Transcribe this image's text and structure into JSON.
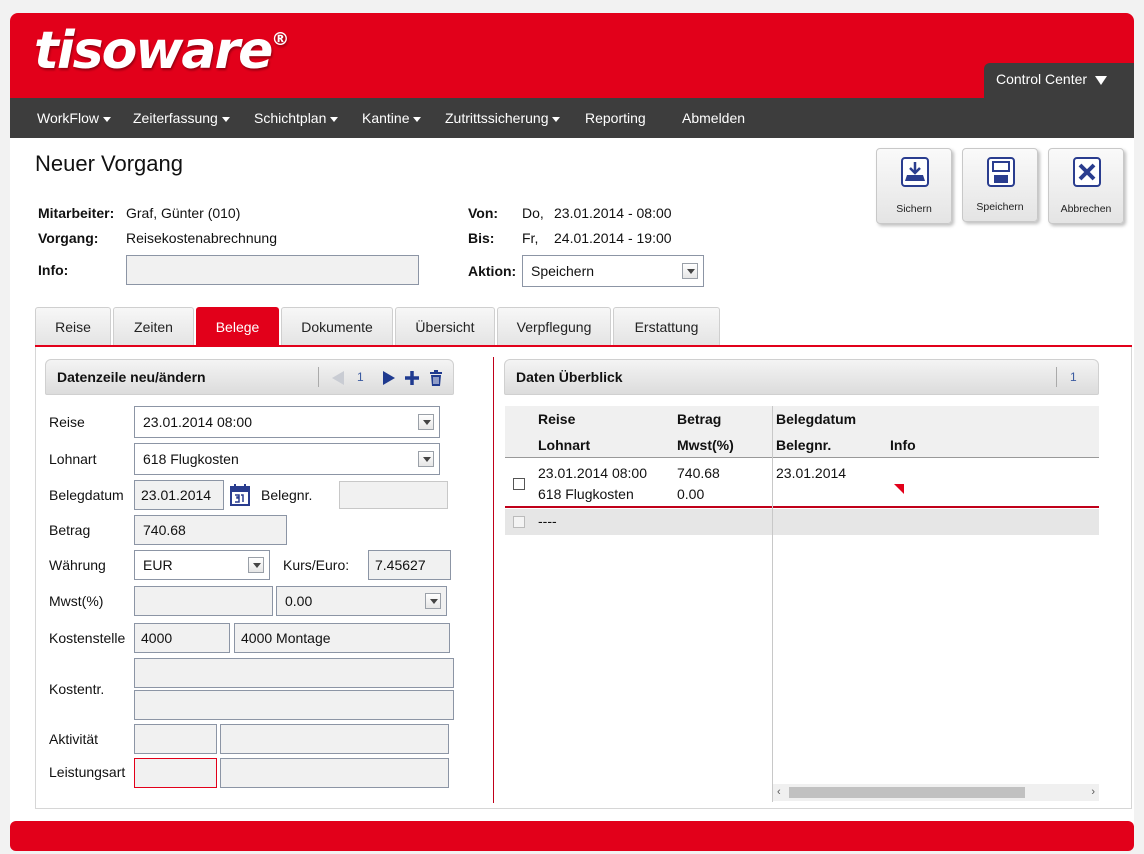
{
  "brand": {
    "logo": "tisoware",
    "registered": "®"
  },
  "control_center": {
    "label": "Control Center"
  },
  "nav": [
    {
      "label": "WorkFlow",
      "dropdown": true
    },
    {
      "label": "Zeiterfassung",
      "dropdown": true
    },
    {
      "label": "Schichtplan",
      "dropdown": true
    },
    {
      "label": "Kantine",
      "dropdown": true
    },
    {
      "label": "Zutrittssicherung",
      "dropdown": true
    },
    {
      "label": "Reporting",
      "dropdown": false
    },
    {
      "label": "Abmelden",
      "dropdown": false
    }
  ],
  "page_title": "Neuer Vorgang",
  "toolbar": {
    "sichern": "Sichern",
    "speichern": "Speichern",
    "abbrechen": "Abbrechen"
  },
  "header_form": {
    "mitarbeiter_label": "Mitarbeiter:",
    "mitarbeiter_value": "Graf, Günter (010)",
    "vorgang_label": "Vorgang:",
    "vorgang_value": "Reisekostenabrechnung",
    "info_label": "Info:",
    "info_value": "",
    "von_label": "Von:",
    "von_day": "Do,",
    "von_value": "23.01.2014 - 08:00",
    "bis_label": "Bis:",
    "bis_day": "Fr,",
    "bis_value": "24.01.2014 - 19:00",
    "aktion_label": "Aktion:",
    "aktion_value": "Speichern"
  },
  "tabs": [
    {
      "label": "Reise",
      "active": false
    },
    {
      "label": "Zeiten",
      "active": false
    },
    {
      "label": "Belege",
      "active": true
    },
    {
      "label": "Dokumente",
      "active": false
    },
    {
      "label": "Übersicht",
      "active": false
    },
    {
      "label": "Verpflegung",
      "active": false
    },
    {
      "label": "Erstattung",
      "active": false
    }
  ],
  "left_panel": {
    "title": "Datenzeile neu/ändern",
    "page": "1",
    "fields": {
      "reise_label": "Reise",
      "reise_value": "23.01.2014 08:00",
      "lohnart_label": "Lohnart",
      "lohnart_value": "618 Flugkosten",
      "belegdatum_label": "Belegdatum",
      "belegdatum_value": "23.01.2014",
      "belegnr_label": "Belegnr.",
      "belegnr_value": "",
      "betrag_label": "Betrag",
      "betrag_value": "740.68",
      "waehrung_label": "Währung",
      "waehrung_value": "EUR",
      "kurs_label": "Kurs/Euro:",
      "kurs_value": "7.45627",
      "mwst_label": "Mwst(%)",
      "mwst_value": "",
      "mwst_select": "0.00",
      "kostenstelle_label": "Kostenstelle",
      "kostenstelle_code": "4000",
      "kostenstelle_name": "4000 Montage",
      "kostentr_label": "Kostentr.",
      "aktivitaet_label": "Aktivität",
      "leistungsart_label": "Leistungsart"
    }
  },
  "right_panel": {
    "title": "Daten Überblick",
    "page": "1",
    "headers": {
      "reise": "Reise",
      "lohnart": "Lohnart",
      "betrag": "Betrag",
      "mwst": "Mwst(%)",
      "belegdatum": "Belegdatum",
      "belegnr": "Belegnr.",
      "info": "Info"
    },
    "rows": [
      {
        "reise": "23.01.2014 08:00",
        "lohnart": "618 Flugkosten",
        "betrag": "740.68",
        "mwst": "0.00",
        "belegdatum": "23.01.2014"
      },
      {
        "reise": "----"
      }
    ]
  },
  "colors": {
    "brand_red": "#e2001a",
    "nav_dark": "#3d3d3d",
    "link_blue": "#2a4a9a"
  }
}
